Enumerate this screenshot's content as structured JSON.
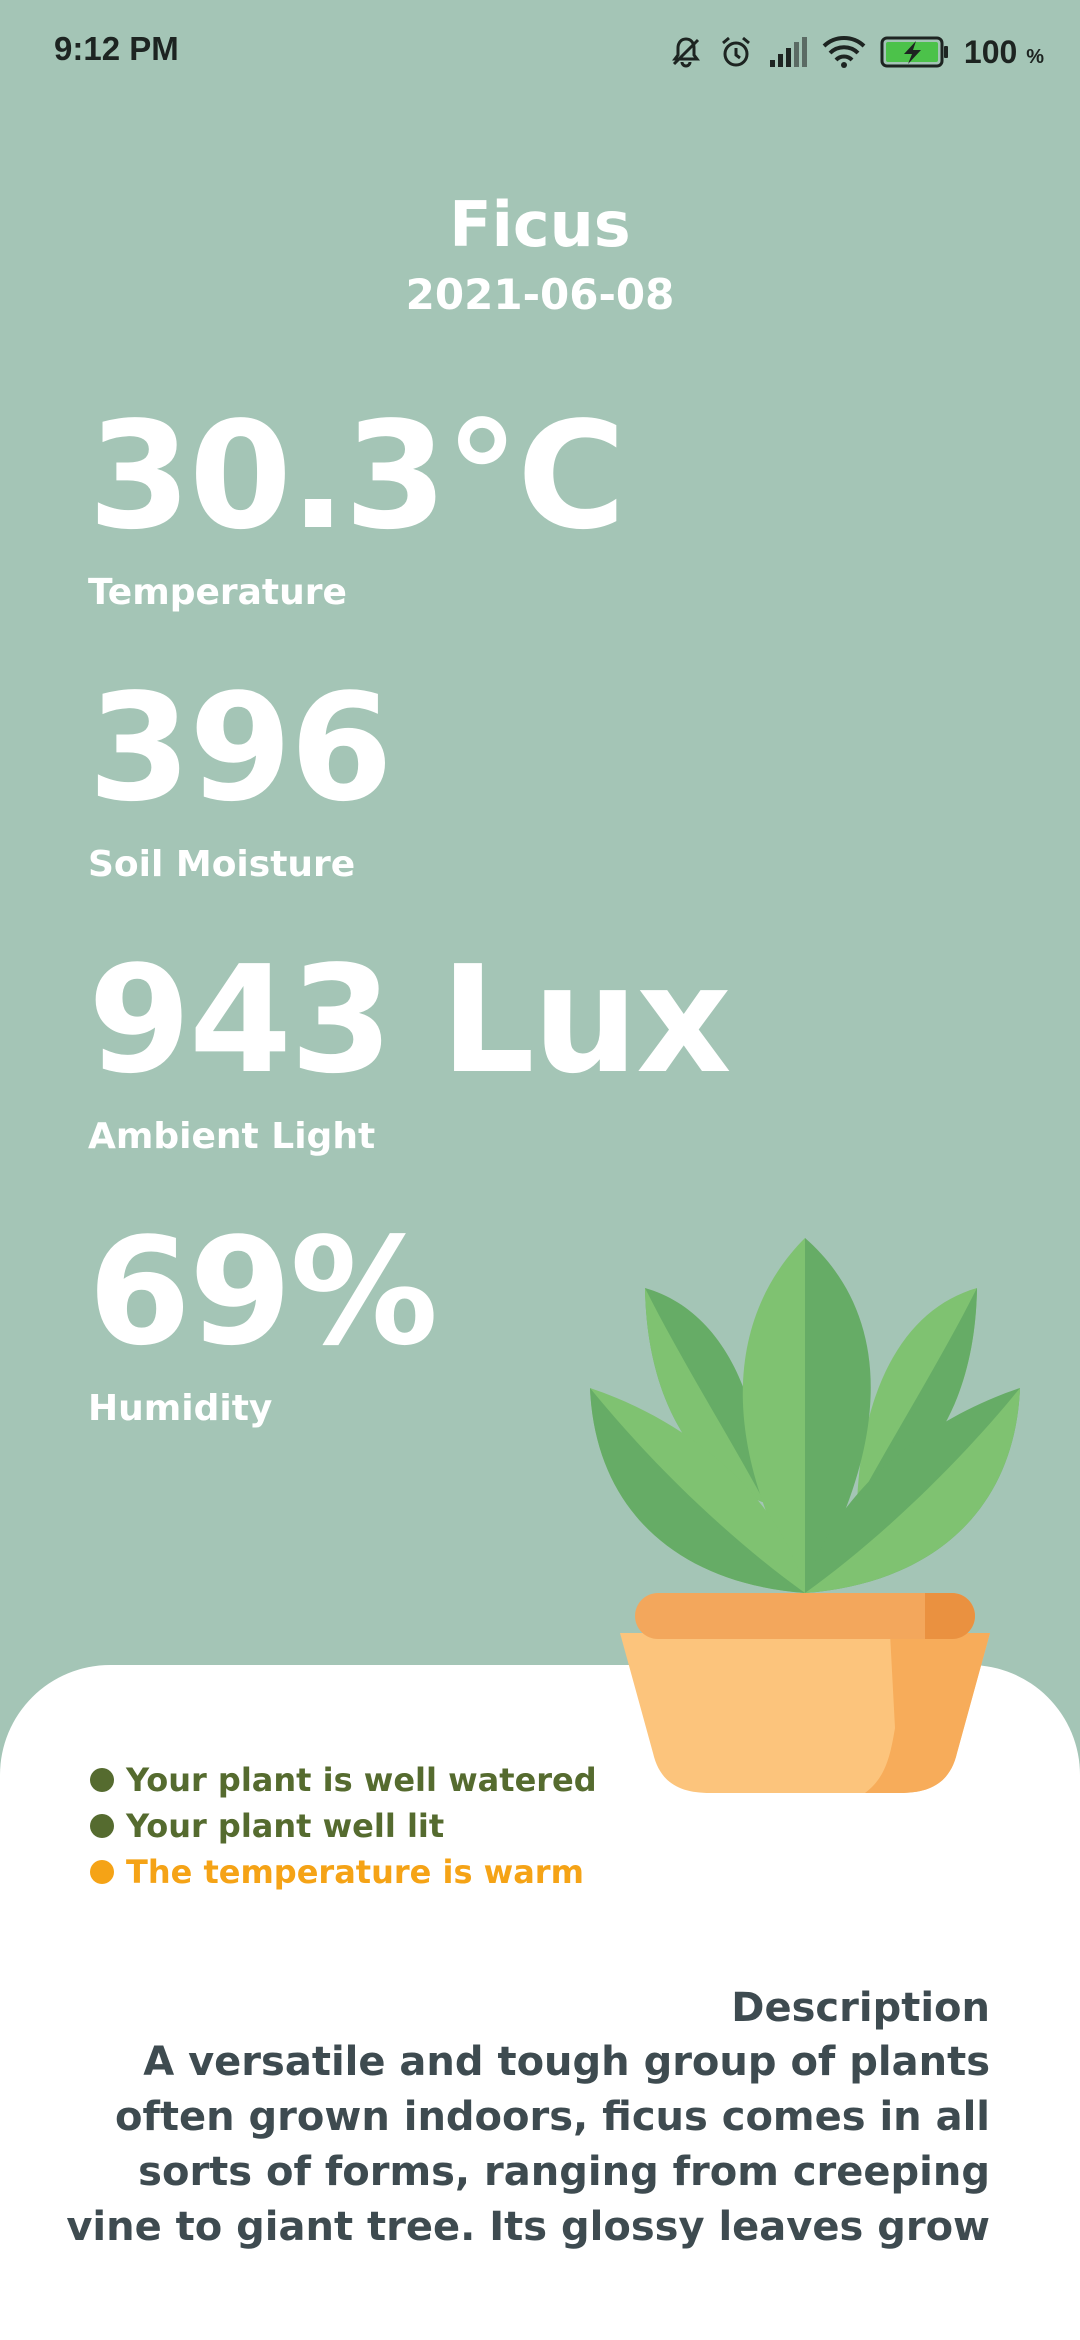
{
  "status_bar": {
    "time": "9:12 PM",
    "battery_percent": "100",
    "battery_unit": "%",
    "icons": [
      "bell-off-icon",
      "alarm-icon",
      "signal-icon",
      "wifi-icon",
      "battery-charging-icon"
    ]
  },
  "plant": {
    "name": "Ficus",
    "date": "2021-06-08"
  },
  "metrics": [
    {
      "value": "30.3°C",
      "label": "Temperature"
    },
    {
      "value": "396",
      "label": "Soil Moisture"
    },
    {
      "value": "943 Lux",
      "label": "Ambient Light"
    },
    {
      "value": "69%",
      "label": "Humidity"
    }
  ],
  "status_messages": [
    {
      "text": "Your plant is well watered",
      "color": "#556b2f"
    },
    {
      "text": "Your plant well lit",
      "color": "#556b2f"
    },
    {
      "text": "The temperature is warm",
      "color": "#f5a316"
    }
  ],
  "description": {
    "title": "Description",
    "text": "A versatile and tough group of plants often grown indoors, ficus comes in all sorts of forms, ranging from creeping vine to giant tree. Its glossy leaves grow"
  },
  "colors": {
    "background": "#a4c5b6",
    "text_primary": "#ffffff",
    "description_text": "#3e4b50",
    "ok_status": "#556b2f",
    "warning_status": "#f5a316"
  }
}
